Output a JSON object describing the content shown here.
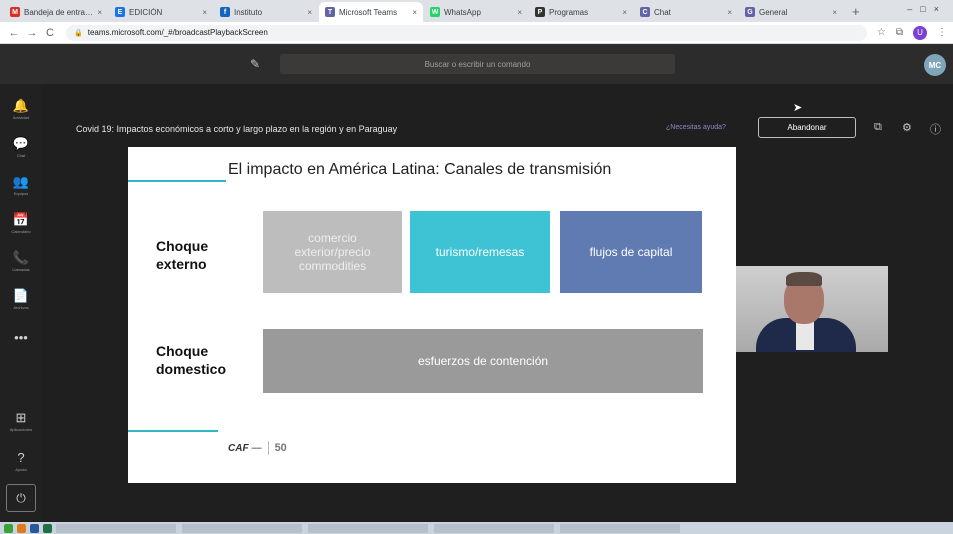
{
  "browser": {
    "tabs": [
      {
        "label": "Bandeja de entrada",
        "fav_color": "#d93025",
        "fav_char": "M",
        "active": false
      },
      {
        "label": "EDICIÓN",
        "fav_color": "#1a73e8",
        "fav_char": "E",
        "active": false
      },
      {
        "label": "Instituto",
        "fav_color": "#1565c0",
        "fav_char": "f",
        "active": false
      },
      {
        "label": "Microsoft Teams",
        "fav_color": "#6264a7",
        "fav_char": "T",
        "active": true
      },
      {
        "label": "WhatsApp",
        "fav_color": "#25d366",
        "fav_char": "W",
        "active": false
      },
      {
        "label": "Programas",
        "fav_color": "#333333",
        "fav_char": "P",
        "active": false
      },
      {
        "label": "Chat",
        "fav_color": "#6264a7",
        "fav_char": "C",
        "active": false
      },
      {
        "label": "General",
        "fav_color": "#6264a7",
        "fav_char": "G",
        "active": false
      }
    ],
    "url": "teams.microsoft.com/_#/broadcastPlaybackScreen",
    "profile_initial": "U"
  },
  "teams": {
    "search_placeholder": "Buscar o escribir un comando",
    "user_initials": "MC",
    "rail": [
      {
        "icon": "bell-icon",
        "glyph": "🔔",
        "label": "Actividad"
      },
      {
        "icon": "chat-icon",
        "glyph": "💬",
        "label": "Chat"
      },
      {
        "icon": "teams-icon",
        "glyph": "👥",
        "label": "Equipos"
      },
      {
        "icon": "calendar-icon",
        "glyph": "📅",
        "label": "Calendario"
      },
      {
        "icon": "phone-icon",
        "glyph": "📞",
        "label": "Llamadas"
      },
      {
        "icon": "files-icon",
        "glyph": "📄",
        "label": "Archivos"
      },
      {
        "icon": "more-icon",
        "glyph": "•••",
        "label": ""
      },
      {
        "icon": "apps-icon",
        "glyph": "⊞",
        "label": "Aplicaciones"
      },
      {
        "icon": "help-icon",
        "glyph": "?",
        "label": "Ayuda"
      }
    ]
  },
  "meeting": {
    "title": "Covid 19: Impactos económicos a corto y largo plazo en la región y en Paraguay",
    "help_link": "¿Necesitas ayuda?",
    "leave_label": "Abandonar"
  },
  "slide": {
    "title": "El impacto en América Latina: Canales de transmisión",
    "row1_label": "Choque externo",
    "row2_label": "Choque domestico",
    "box_commerce": "comercio exterior/precio commodities",
    "box_tourism": "turismo/remesas",
    "box_capital": "flujos de capital",
    "box_containment": "esfuerzos de contención",
    "logo_caf": "CAF",
    "logo_years": "50"
  }
}
